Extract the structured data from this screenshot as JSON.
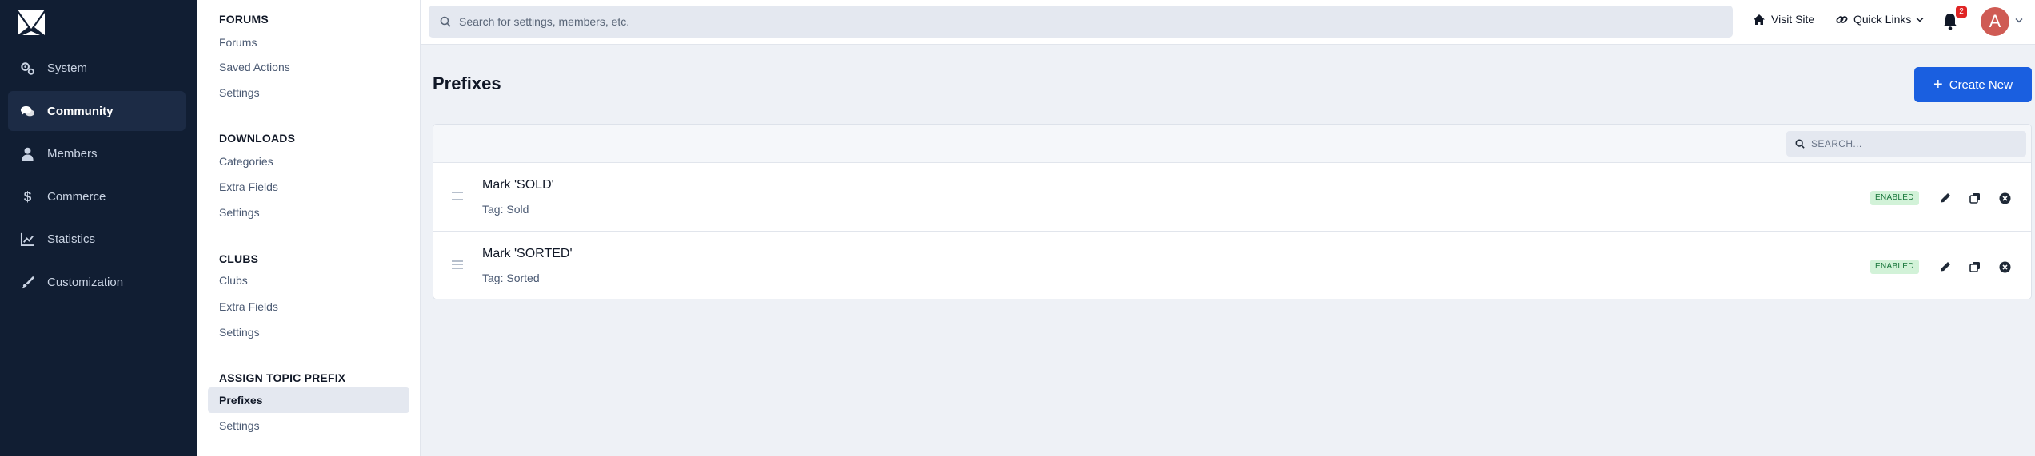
{
  "nav": {
    "items": [
      {
        "label": "System",
        "icon": "gears-icon"
      },
      {
        "label": "Community",
        "icon": "comments-icon"
      },
      {
        "label": "Members",
        "icon": "user-icon"
      },
      {
        "label": "Commerce",
        "icon": "dollar-icon"
      },
      {
        "label": "Statistics",
        "icon": "chart-line-icon"
      },
      {
        "label": "Customization",
        "icon": "paintbrush-icon"
      }
    ],
    "active": "Community"
  },
  "subnav": {
    "sections": [
      {
        "title": "FORUMS",
        "links": [
          "Forums",
          "Saved Actions",
          "Settings"
        ]
      },
      {
        "title": "DOWNLOADS",
        "links": [
          "Categories",
          "Extra Fields",
          "Settings"
        ]
      },
      {
        "title": "CLUBS",
        "links": [
          "Clubs",
          "Extra Fields",
          "Settings"
        ]
      },
      {
        "title": "ASSIGN TOPIC PREFIX",
        "links": [
          "Prefixes",
          "Settings"
        ]
      }
    ],
    "active": "Prefixes"
  },
  "topbar": {
    "search_placeholder": "Search for settings, members, etc.",
    "visit_site": "Visit Site",
    "quick_links": "Quick Links",
    "notification_count": "2",
    "avatar_letter": "A"
  },
  "main": {
    "title": "Prefixes",
    "create_button": "Create New",
    "search_placeholder": "SEARCH...",
    "rows": [
      {
        "title": "Mark 'SOLD'",
        "tag": "Tag: Sold",
        "status": "ENABLED"
      },
      {
        "title": "Mark 'SORTED'",
        "tag": "Tag: Sorted",
        "status": "ENABLED"
      }
    ]
  },
  "colors": {
    "sidebar_bg": "#111e33",
    "accent": "#1a5fe0",
    "enabled_bg": "#d2f2d8",
    "enabled_text": "#18753a",
    "badge": "#e02424",
    "avatar": "#cf5b54"
  }
}
